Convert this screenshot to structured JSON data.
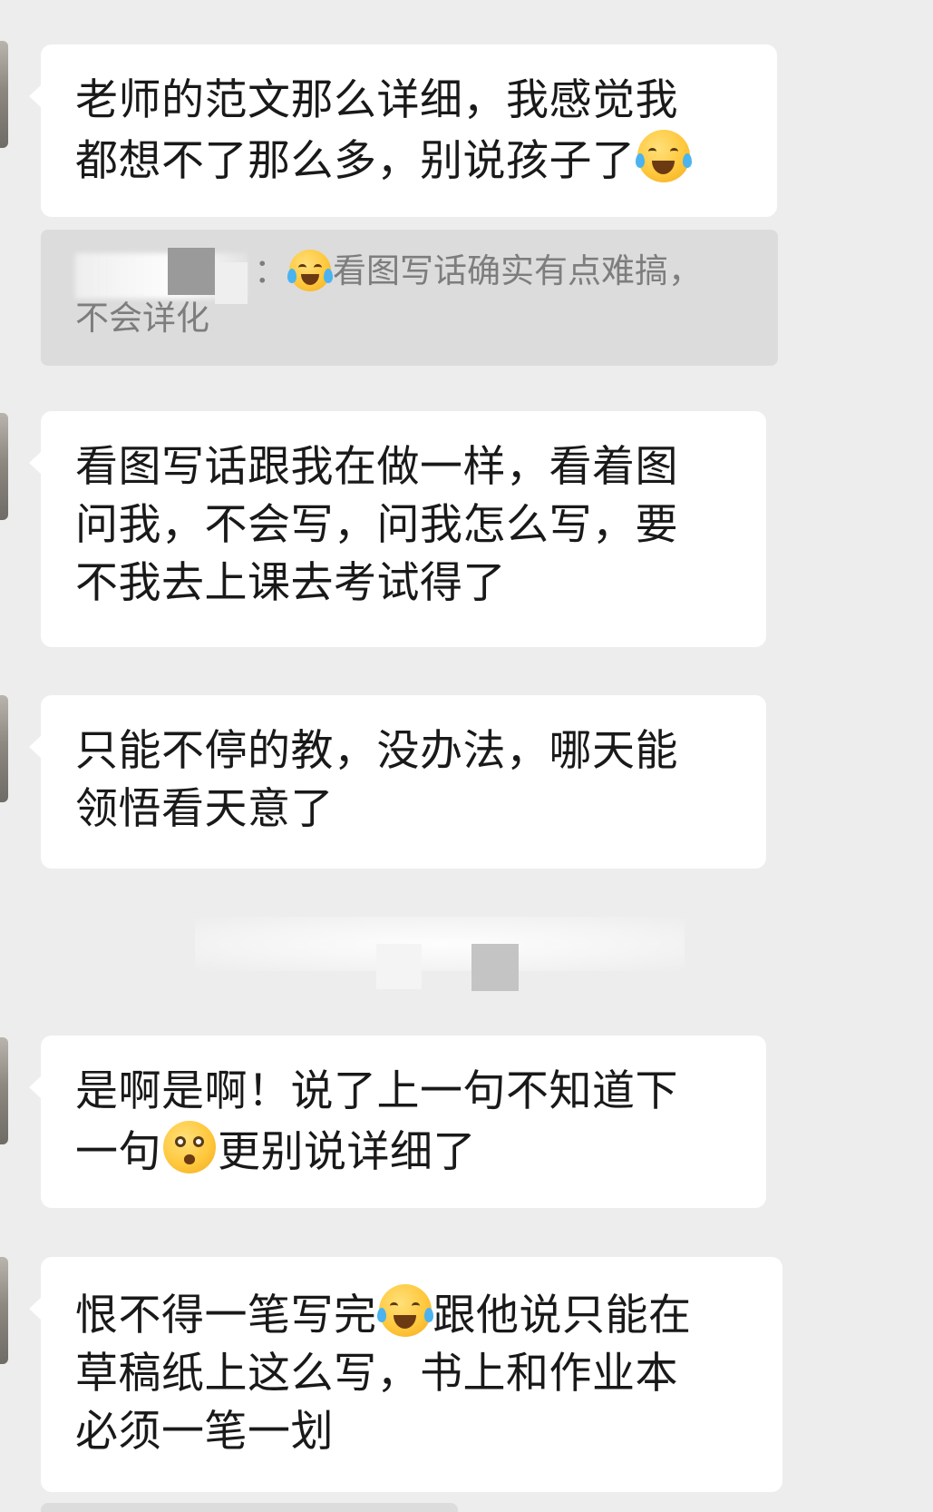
{
  "messages": [
    {
      "lines": [
        "老师的范文那么详细，我感觉我",
        "都想不了那么多，别说孩子了"
      ],
      "trailing_emoji": "face-with-tears-emoji"
    },
    {
      "quote": {
        "sender_suffix": "：",
        "line1": "看图写话确实有点难搞，",
        "line2": "不会详化",
        "emoji": "face-with-tears-emoji"
      }
    },
    {
      "lines": [
        "看图写话跟我在做一样，看着图",
        "问我，不会写，问我怎么写，要",
        "不我去上课去考试得了"
      ]
    },
    {
      "lines": [
        "只能不停的教，没办法，哪天能",
        "领悟看天意了"
      ]
    },
    {
      "line1": "是啊是啊！说了上一句不知道下",
      "line2_before": "一句",
      "line2_after": "更别说详细了",
      "emoji": "surprised-face-emoji"
    },
    {
      "line1_before": "恨不得一笔写完",
      "line1_after": "跟他说只能在",
      "line2": "草稿纸上这么写，书上和作业本",
      "line3": "必须一笔一划",
      "emoji": "tears-of-joy-emoji"
    }
  ],
  "colors": {
    "background": "#ededed",
    "bubble": "#ffffff",
    "quote_background": "#dcdcdc",
    "text": "#191919",
    "quote_text": "#7d7d7d"
  }
}
